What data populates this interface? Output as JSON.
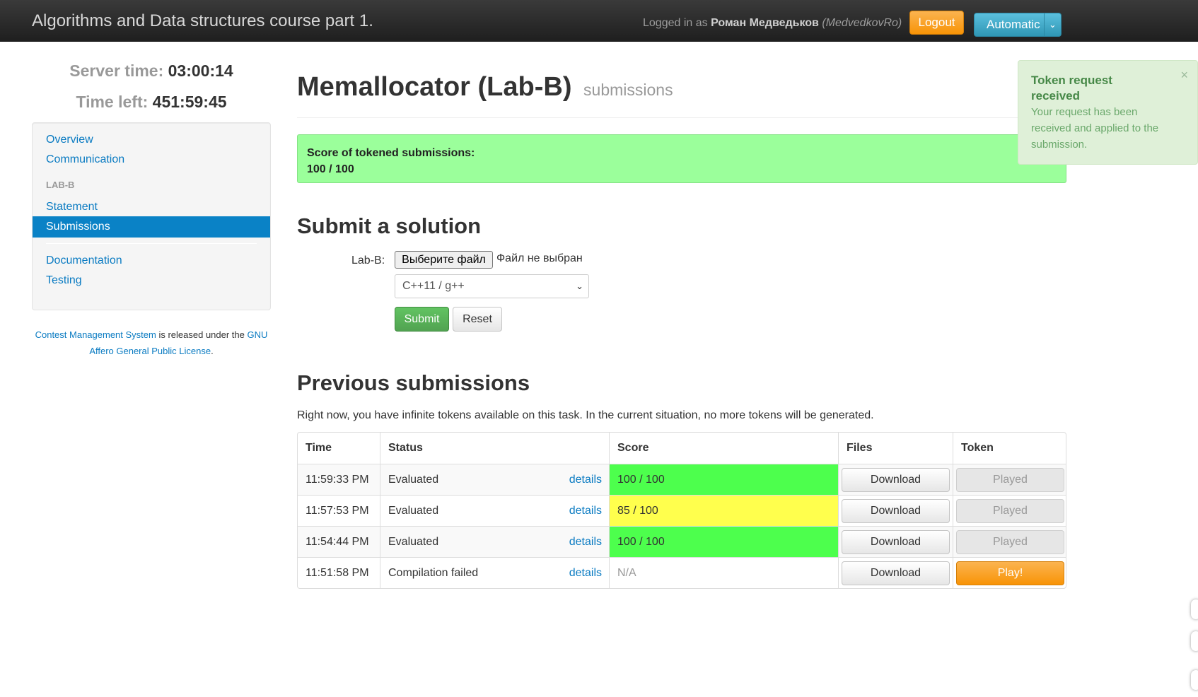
{
  "header": {
    "brand": "Algorithms and Data structures course part 1.",
    "logged_in_prefix": "Logged in as",
    "user_name": "Роман Медведьков",
    "user_login": "(MedvedkovRo)",
    "logout_label": "Logout",
    "language_selector": "Automatic"
  },
  "sidebar": {
    "server_time_label": "Server time:",
    "server_time": "03:00:14",
    "time_left_label": "Time left:",
    "time_left": "451:59:45",
    "nav": {
      "overview": "Overview",
      "communication": "Communication",
      "task_header": "LAB-B",
      "statement": "Statement",
      "submissions": "Submissions",
      "documentation": "Documentation",
      "testing": "Testing"
    },
    "footer": {
      "cms_link": "Contest Management System",
      "middle": "is released under the",
      "license_link": "GNU Affero General Public License",
      "end": "."
    }
  },
  "main": {
    "title": "Memallocator (Lab-B)",
    "subtitle": "submissions",
    "score_label": "Score of tokened submissions:",
    "score_value": "100 / 100",
    "submit_title": "Submit a solution",
    "file_label": "Lab-B:",
    "file_button": "Выберите файл",
    "file_status": "Файл не выбран",
    "language": "C++11 / g++",
    "submit_button": "Submit",
    "reset_button": "Reset",
    "previous_title": "Previous submissions",
    "tokens_note": "Right now, you have infinite tokens available on this task. In the current situation, no more tokens will be generated.",
    "table": {
      "headers": {
        "time": "Time",
        "status": "Status",
        "score": "Score",
        "files": "Files",
        "token": "Token"
      },
      "rows": [
        {
          "time": "11:59:33 PM",
          "status": "Evaluated",
          "details": "details",
          "score": "100 / 100",
          "files": "Download",
          "token": "Played"
        },
        {
          "time": "11:57:53 PM",
          "status": "Evaluated",
          "details": "details",
          "score": "85 / 100",
          "files": "Download",
          "token": "Played"
        },
        {
          "time": "11:54:44 PM",
          "status": "Evaluated",
          "details": "details",
          "score": "100 / 100",
          "files": "Download",
          "token": "Played"
        },
        {
          "time": "11:51:58 PM",
          "status": "Compilation failed",
          "details": "details",
          "score": "N/A",
          "files": "Download",
          "token": "Play!"
        }
      ]
    }
  },
  "notification": {
    "title": "Token request received",
    "body": "Your request has been received and applied to the submission.",
    "close": "×"
  },
  "colors": {
    "score_full": "#4dff4d",
    "score_partial": "#ffff4d",
    "score_box": "#9bff9b",
    "accent_blue": "#0a82c6",
    "warning_orange": "#f89406"
  }
}
